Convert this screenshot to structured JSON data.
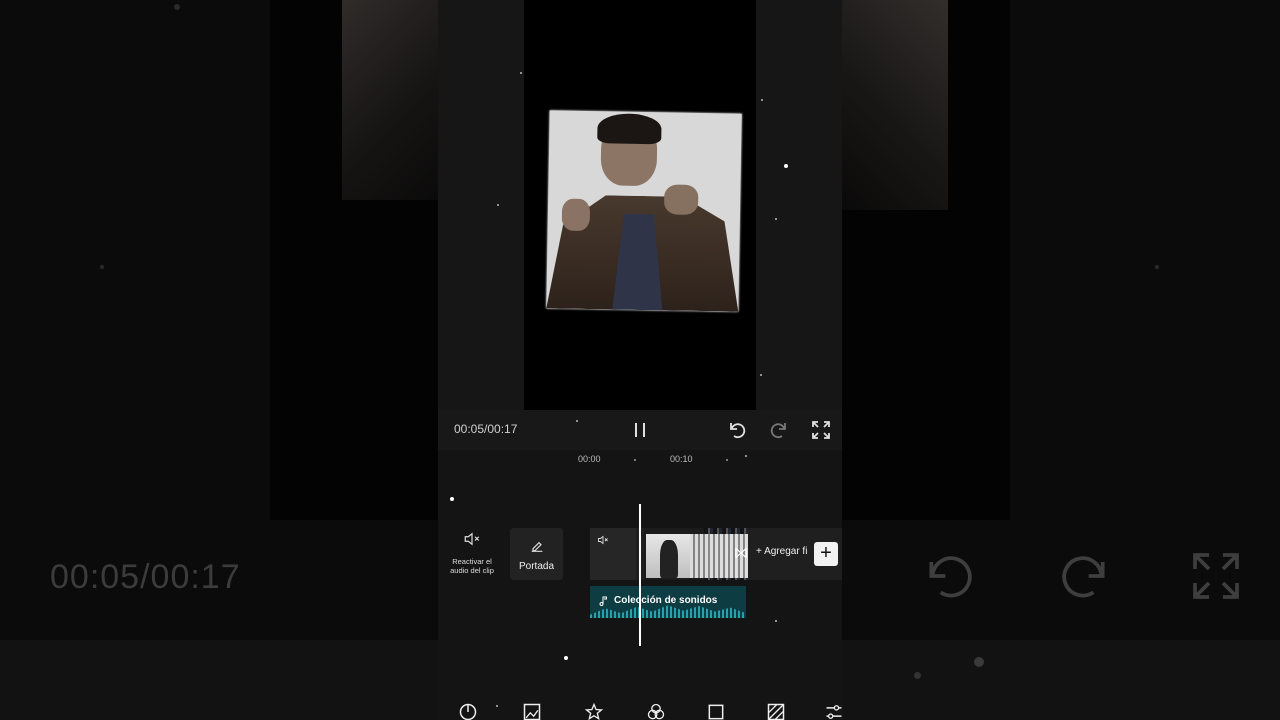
{
  "player": {
    "time_readout": "00:05/00:17",
    "timeline_ticks": [
      "00:00",
      "00:10"
    ]
  },
  "timeline": {
    "mute_label": "Reactivar el audio del clip",
    "cover_label": "Portada",
    "add_clip_label": "Agregar fi",
    "audio_label": "Colección de sonidos"
  },
  "background": {
    "time_readout": "00:05/00:17"
  },
  "icons": {
    "pause": "pause-icon",
    "undo": "undo-icon",
    "redo": "redo-icon",
    "fullscreen": "fullscreen-icon",
    "mute": "speaker-mute-icon",
    "cover": "pencil-icon",
    "add": "plus-icon",
    "note": "music-note-icon",
    "transition": "transition-icon"
  },
  "colors": {
    "audio_track": "#0e3c43",
    "waveform": "#2ec3d2",
    "background": "#0b0b0b"
  }
}
